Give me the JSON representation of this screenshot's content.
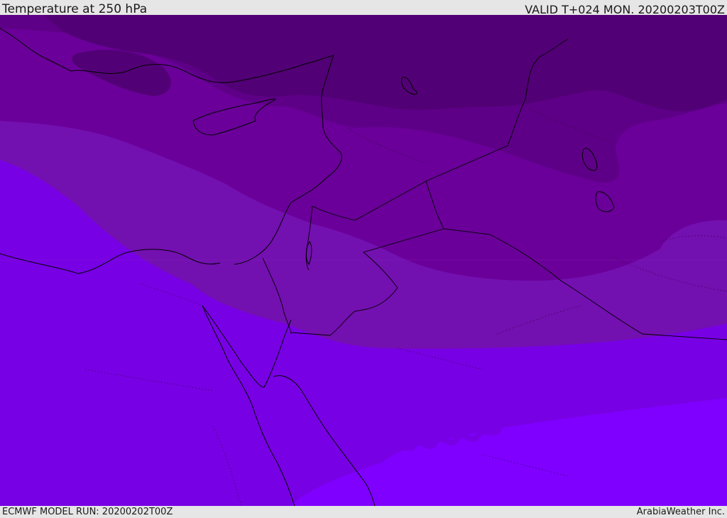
{
  "header": {
    "title": "Temperature at 250 hPa",
    "valid": "VALID T+024 MON. 20200203T00Z"
  },
  "footer": {
    "model_run": "ECMWF MODEL RUN: 20200202T00Z",
    "brand": "ArabiaWeather Inc."
  },
  "colors": {
    "band_warmest": "#7f00ff",
    "band_warm": "#7800e4",
    "band_mid": "#7310b0",
    "band_cool": "#6a0099",
    "band_cold": "#5e0087",
    "band_coldest": "#520075",
    "coastline": "#000000"
  }
}
